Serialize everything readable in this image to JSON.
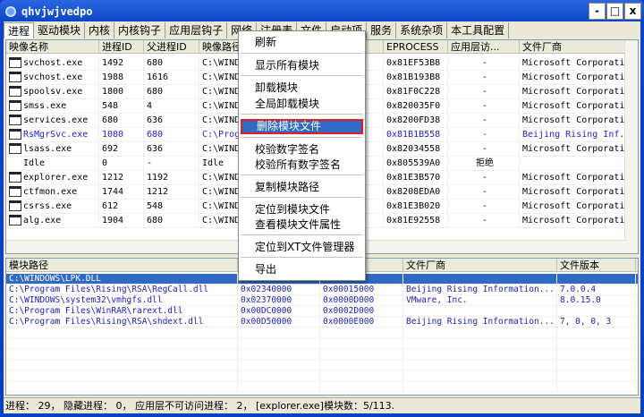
{
  "window": {
    "title": "qhvjwjvedpo",
    "minimize": "-",
    "maximize": "□",
    "close": "x"
  },
  "tabs": [
    "进程",
    "驱动模块",
    "内核",
    "内核钩子",
    "应用层钩子",
    "网络",
    "注册表",
    "文件",
    "启动项",
    "服务",
    "系统杂项",
    "本工具配置"
  ],
  "process_table": {
    "columns": [
      "映像名称",
      "进程ID",
      "父进程ID",
      "映像路径",
      "",
      "EPROCESS",
      "应用层访...",
      "文件厂商"
    ],
    "rows": [
      [
        "svchost.exe",
        "1492",
        "680",
        "C:\\WINDO",
        "0x81EF53B8",
        "-",
        "Microsoft Corporation"
      ],
      [
        "svchost.exe",
        "1988",
        "1616",
        "C:\\WINDO",
        "0x81B193B8",
        "-",
        "Microsoft Corporation"
      ],
      [
        "spoolsv.exe",
        "1800",
        "680",
        "C:\\WINDO",
        "0x81F0C228",
        "-",
        "Microsoft Corporation"
      ],
      [
        "smss.exe",
        "548",
        "4",
        "C:\\WINDO",
        "0x820035F0",
        "-",
        "Microsoft Corporation"
      ],
      [
        "services.exe",
        "680",
        "636",
        "C:\\WINDO",
        "0x8200FD38",
        "-",
        "Microsoft Corporation"
      ],
      [
        "RsMgrSvc.exe",
        "1080",
        "680",
        "C:\\Prog",
        "0x81B1B558",
        "-",
        "Beijing Rising Inf.."
      ],
      [
        "lsass.exe",
        "692",
        "636",
        "C:\\WINDO",
        "0x82034558",
        "-",
        "Microsoft Corporation"
      ],
      [
        "Idle",
        "0",
        "-",
        "Idle",
        "0x805539A0",
        "拒绝",
        ""
      ],
      [
        "explorer.exe",
        "1212",
        "1192",
        "C:\\WINDO",
        "0x81E3B570",
        "-",
        "Microsoft Corporation"
      ],
      [
        "ctfmon.exe",
        "1744",
        "1212",
        "C:\\WINDO",
        "0x8208EDA0",
        "-",
        "Microsoft Corporation"
      ],
      [
        "csrss.exe",
        "612",
        "548",
        "C:\\WINDO",
        "0x81E3B020",
        "-",
        "Microsoft Corporation"
      ],
      [
        "alg.exe",
        "1904",
        "680",
        "C:\\WINDO",
        "0x81E92558",
        "-",
        "Microsoft Corporation"
      ]
    ]
  },
  "module_table": {
    "columns": [
      "模块路径",
      "",
      "",
      "文件厂商",
      "文件版本"
    ],
    "rows": [
      [
        "C:\\WINDOWS\\LPK.DLL",
        "",
        "",
        "",
        ""
      ],
      [
        "C:\\Program Files\\Rising\\RSA\\RegCall.dll",
        "0x02340000",
        "0x00015000",
        "Beijing Rising Information...",
        "7.0.0.4"
      ],
      [
        "C:\\WINDOWS\\system32\\vmhgfs.dll",
        "0x02370000",
        "0x0000D000",
        "VMware, Inc.",
        "8.0.15.0"
      ],
      [
        "C:\\Program Files\\WinRAR\\rarext.dll",
        "0x00DC0000",
        "0x0002D000",
        "",
        ""
      ],
      [
        "C:\\Program Files\\Rising\\RSA\\shdext.dll",
        "0x00D50000",
        "0x0000E000",
        "Beijing Rising Information...",
        "7, 0, 0, 3"
      ]
    ]
  },
  "context_menu": {
    "items": [
      "刷新",
      "显示所有模块",
      "卸载模块",
      "全局卸载模块",
      "删除模块文件",
      "校验数字签名",
      "校验所有数字签名",
      "复制模块路径",
      "定位到模块文件",
      "查看模块文件属性",
      "定位到XT文件管理器",
      "导出"
    ],
    "highlighted": "删除模块文件"
  },
  "status": "进程： 29， 隐藏进程： 0， 应用层不可访问进程： 2， [explorer.exe]模块数：5/113.",
  "colors": {
    "titlebar": "#0b45c8",
    "selection": "#316ac5",
    "highlight_border": "#e02020",
    "vendor_text": "#2020d0"
  }
}
